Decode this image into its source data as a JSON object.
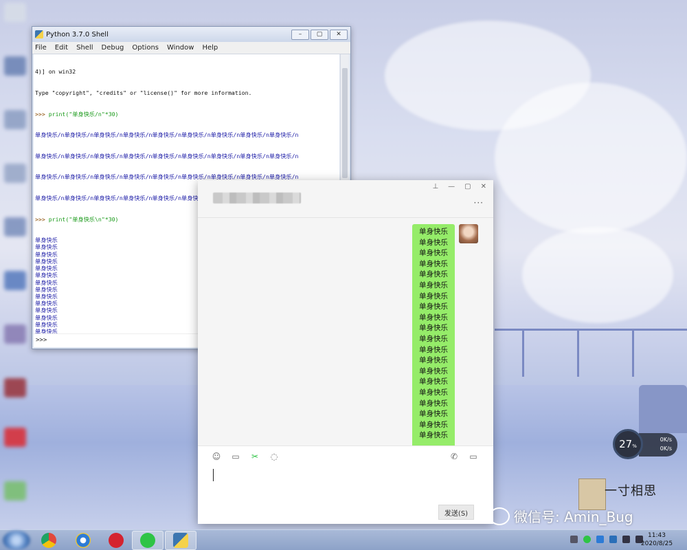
{
  "python_window": {
    "title": "Python 3.7.0 Shell",
    "controls": [
      "–",
      "▢",
      "✕"
    ],
    "menu": [
      "File",
      "Edit",
      "Shell",
      "Debug",
      "Options",
      "Window",
      "Help"
    ],
    "header_line1": "4)] on win32",
    "header_line2": "Type \"copyright\", \"credits\" or \"license()\" for more information.",
    "cmd1_prompt": ">>> ",
    "cmd1": "print(\"单身快乐/n\"*30)",
    "out1": [
      "单身快乐/n单身快乐/n单身快乐/n单身快乐/n单身快乐/n单身快乐/n单身快乐/n单身快乐/n单身快乐/n",
      "单身快乐/n单身快乐/n单身快乐/n单身快乐/n单身快乐/n单身快乐/n单身快乐/n单身快乐/n单身快乐/n",
      "单身快乐/n单身快乐/n单身快乐/n单身快乐/n单身快乐/n单身快乐/n单身快乐/n单身快乐/n单身快乐/n",
      "单身快乐/n单身快乐/n单身快乐/n单身快乐/n单身快乐/n单身快乐/n单身快乐/n单身快乐/n单身快乐/n"
    ],
    "cmd2_prompt": ">>> ",
    "cmd2": "print(\"单身快乐\\n\"*30)",
    "out2_line": "单身快乐",
    "out2_count": 30,
    "final_prompt": ">>>"
  },
  "wechat_window": {
    "controls": [
      "⊥",
      "—",
      "▢",
      "✕"
    ],
    "more": "···",
    "bubble_line": "单身快乐",
    "bubble_count": 20,
    "tools_left": [
      "☺",
      "▭",
      "✂",
      "◌"
    ],
    "tools_right": [
      "✆",
      "▭"
    ],
    "send_label": "发送(S)"
  },
  "perf_widget": {
    "cpu": "27",
    "cpu_unit": "%",
    "up": "0K/s",
    "down": "0K/s"
  },
  "watermark": {
    "stamp_text": "一寸相思",
    "label": "微信号: Amin_Bug"
  },
  "taskbar": {
    "time": "11:43",
    "date": "2020/8/25",
    "colors": {
      "chrome": "#e2483c",
      "ie": "#2d7bd6",
      "netease": "#d4232f",
      "wechat": "#2ec445",
      "python": "#3b76b0"
    }
  }
}
